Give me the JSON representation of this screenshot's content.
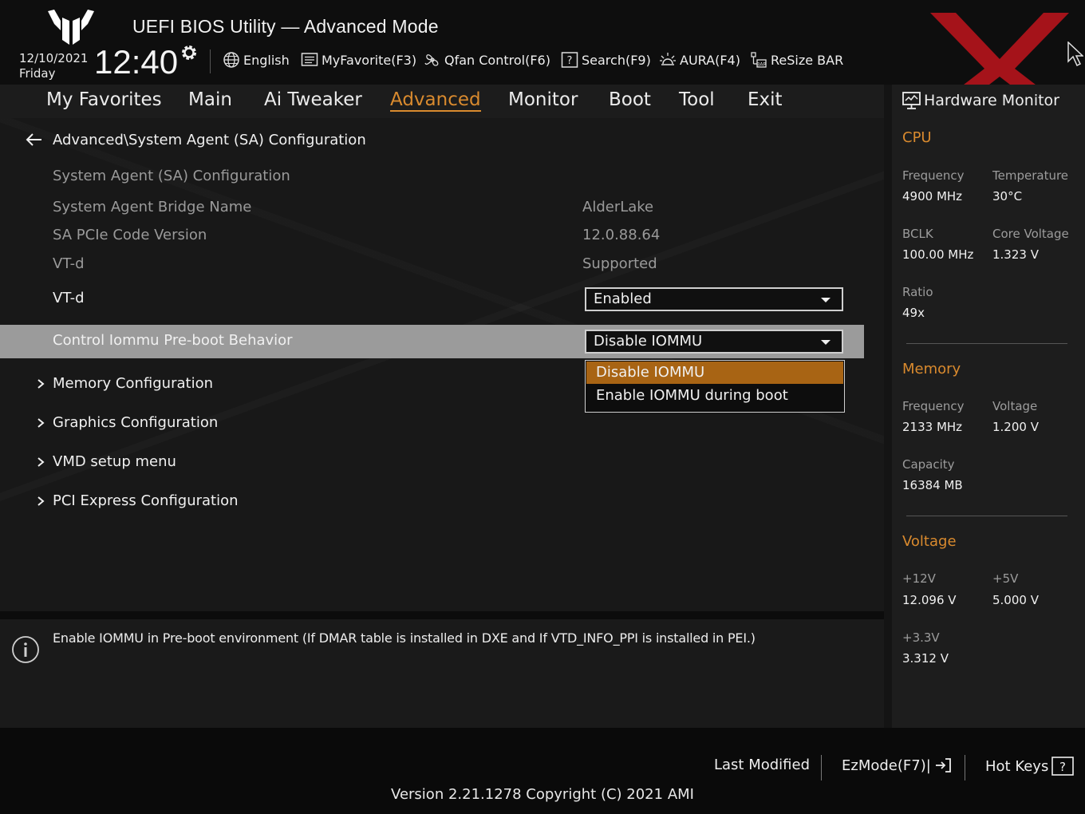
{
  "header": {
    "title": "UEFI BIOS Utility — Advanced Mode",
    "date": "12/10/2021",
    "day": "Friday",
    "time": "12:40",
    "tools": {
      "language": "English",
      "my_favorite": "MyFavorite(F3)",
      "qfan": "Qfan Control(F6)",
      "search": "Search(F9)",
      "aura": "AURA(F4)",
      "resize_bar": "ReSize BAR"
    }
  },
  "nav": {
    "tabs": [
      {
        "label": "My Favorites"
      },
      {
        "label": "Main"
      },
      {
        "label": "Ai Tweaker"
      },
      {
        "label": "Advanced"
      },
      {
        "label": "Monitor"
      },
      {
        "label": "Boot"
      },
      {
        "label": "Tool"
      },
      {
        "label": "Exit"
      }
    ],
    "active": "Advanced"
  },
  "main": {
    "breadcrumb": "Advanced\\System Agent (SA) Configuration",
    "section_header": "System Agent (SA) Configuration",
    "info_rows": [
      {
        "label": "System Agent Bridge Name",
        "value": "AlderLake"
      },
      {
        "label": "SA PCIe Code Version",
        "value": "12.0.88.64"
      },
      {
        "label": "VT-d",
        "value": "Supported"
      }
    ],
    "settings": [
      {
        "label": "VT-d",
        "value": "Enabled"
      },
      {
        "label": "Control Iommu Pre-boot Behavior",
        "value": "Disable IOMMU"
      }
    ],
    "dropdown_options": [
      "Disable IOMMU",
      "Enable IOMMU during boot"
    ],
    "submenus": [
      {
        "label": "Memory Configuration"
      },
      {
        "label": "Graphics Configuration"
      },
      {
        "label": "VMD setup menu"
      },
      {
        "label": "PCI Express Configuration"
      }
    ]
  },
  "help": {
    "text": "Enable IOMMU in Pre-boot environment (If DMAR table is installed in DXE and If VTD_INFO_PPI is installed in PEI.)"
  },
  "hardware_monitor": {
    "title": "Hardware Monitor",
    "cpu": {
      "heading": "CPU",
      "frequency_label": "Frequency",
      "frequency": "4900 MHz",
      "temperature_label": "Temperature",
      "temperature": "30°C",
      "bclk_label": "BCLK",
      "bclk": "100.00 MHz",
      "core_voltage_label": "Core Voltage",
      "core_voltage": "1.323 V",
      "ratio_label": "Ratio",
      "ratio": "49x"
    },
    "memory": {
      "heading": "Memory",
      "frequency_label": "Frequency",
      "frequency": "2133 MHz",
      "voltage_label": "Voltage",
      "voltage": "1.200 V",
      "capacity_label": "Capacity",
      "capacity": "16384 MB"
    },
    "voltage": {
      "heading": "Voltage",
      "v12_label": "+12V",
      "v12": "12.096 V",
      "v5_label": "+5V",
      "v5": "5.000 V",
      "v33_label": "+3.3V",
      "v33": "3.312 V"
    }
  },
  "footer": {
    "last_modified": "Last Modified",
    "ezmode": "EzMode(F7)|",
    "hot_keys": "Hot Keys",
    "version": "Version 2.21.1278 Copyright (C) 2021 AMI"
  },
  "colors": {
    "accent": "#d98a2e",
    "highlight_option": "#a86414",
    "selected_row": "#9b9b9b",
    "watermark": "#c0141c"
  }
}
